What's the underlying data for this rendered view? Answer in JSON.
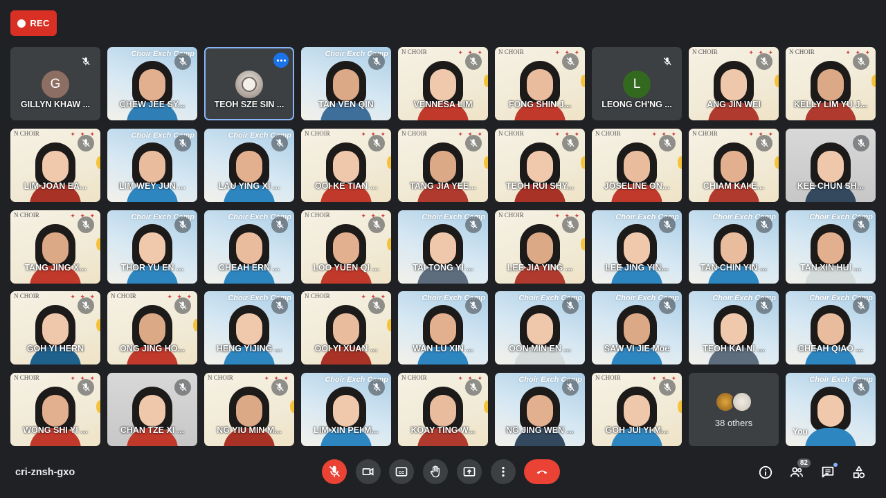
{
  "recording": {
    "label": "REC"
  },
  "meeting_code": "cri-znsh-gxo",
  "participants_count": "82",
  "colors": {
    "accent": "#1a73e8",
    "danger": "#ea4335",
    "bg": "#202124",
    "tile": "#3c4043"
  },
  "tile_decor": {
    "choir": "N CHOIR",
    "camp": "Choir Exch Camp",
    "stars": "✦ ✦ ✦"
  },
  "tiles": [
    {
      "name": "GILLYN KHAW ...",
      "kind": "avatar",
      "initial": "G",
      "avatar_color": "#8d6e63"
    },
    {
      "name": "CHEW JEE SY...",
      "kind": "video",
      "bg": "bg1",
      "shirt": "#2f7fb6"
    },
    {
      "name": "TEOH SZE SIN ...",
      "kind": "photo-avatar",
      "selected": true
    },
    {
      "name": "TAN VEN QIN",
      "kind": "video",
      "bg": "bg1",
      "shirt": "#3d6f9a"
    },
    {
      "name": "VENNESA LIM",
      "kind": "video",
      "bg": "bg0",
      "shirt": "#c0392b"
    },
    {
      "name": "FONG SHIN J...",
      "kind": "video",
      "bg": "bg0",
      "shirt": "#c0392b"
    },
    {
      "name": "LEONG CH'NG ...",
      "kind": "avatar",
      "initial": "L",
      "avatar_color": "#33691e"
    },
    {
      "name": "ANG JIN WEI",
      "kind": "video",
      "bg": "bg0",
      "shirt": "#b03a2e"
    },
    {
      "name": "KELLY LIM YU J...",
      "kind": "video",
      "bg": "bg0",
      "shirt": "#b03a2e"
    },
    {
      "name": "LIM JOAN EA...",
      "kind": "video",
      "bg": "bg0",
      "shirt": "#a93226"
    },
    {
      "name": "LIM WEY JUN ...",
      "kind": "video",
      "bg": "bg1",
      "shirt": "#2e86c1"
    },
    {
      "name": "LAU YING XI ...",
      "kind": "video",
      "bg": "bg1",
      "shirt": "#2e86c1"
    },
    {
      "name": "OOI KE TIAN ...",
      "kind": "video",
      "bg": "bg0",
      "shirt": "#c0392b"
    },
    {
      "name": "TANG JIA YEE...",
      "kind": "video",
      "bg": "bg0",
      "shirt": "#b03a2e"
    },
    {
      "name": "TEOH RUI SHY...",
      "kind": "video",
      "bg": "bg0",
      "shirt": "#a93226"
    },
    {
      "name": "JOSELINE ON...",
      "kind": "video",
      "bg": "bg0",
      "shirt": "#c0392b"
    },
    {
      "name": "CHIAM KAI E...",
      "kind": "video",
      "bg": "bg0",
      "shirt": "#b03a2e"
    },
    {
      "name": "KEE CHUN SH...",
      "kind": "video",
      "bg": "bg2",
      "shirt": "#34495e"
    },
    {
      "name": "TANG JING X...",
      "kind": "video",
      "bg": "bg0",
      "shirt": "#c0392b"
    },
    {
      "name": "THOR YU EN ...",
      "kind": "video",
      "bg": "bg1",
      "shirt": "#2e86c1"
    },
    {
      "name": "CHEAH ERN ...",
      "kind": "video",
      "bg": "bg1",
      "shirt": "#2e86c1"
    },
    {
      "name": "LOO YUEN QI ...",
      "kind": "video",
      "bg": "bg0",
      "shirt": "#c0392b"
    },
    {
      "name": "TAI TONG YI ...",
      "kind": "video",
      "bg": "bg1",
      "shirt": "#5d6d7e"
    },
    {
      "name": "LEE JIA YING ...",
      "kind": "video",
      "bg": "bg0",
      "shirt": "#b03a2e"
    },
    {
      "name": "LEE JING YIN...",
      "kind": "video",
      "bg": "bg1",
      "shirt": "#2e86c1"
    },
    {
      "name": "TAN CHIN YIN ...",
      "kind": "video",
      "bg": "bg1",
      "shirt": "#2e86c1"
    },
    {
      "name": "TAN XIN HUI ...",
      "kind": "video",
      "bg": "bg1",
      "shirt": "#d5dbdb"
    },
    {
      "name": "GOH YI HERN",
      "kind": "video",
      "bg": "bg0",
      "shirt": "#1f618d"
    },
    {
      "name": "ONG JING HO...",
      "kind": "video",
      "bg": "bg0",
      "shirt": "#c0392b"
    },
    {
      "name": "HENG YIJING ...",
      "kind": "video",
      "bg": "bg1",
      "shirt": "#2e86c1"
    },
    {
      "name": "OOI YI XUAN ...",
      "kind": "video",
      "bg": "bg0",
      "shirt": "#a93226"
    },
    {
      "name": "WAN LU XIN ...",
      "kind": "video",
      "bg": "bg1",
      "shirt": "#2e86c1"
    },
    {
      "name": "OON MIN EN ...",
      "kind": "video",
      "bg": "bg1",
      "shirt": "#d5dbdb"
    },
    {
      "name": "SAW VI JIE Moe",
      "kind": "video",
      "bg": "bg1",
      "shirt": "#2e86c1"
    },
    {
      "name": "TEOH KAI NI ...",
      "kind": "video",
      "bg": "bg1",
      "shirt": "#5d6d7e"
    },
    {
      "name": "CHEAH QIAO ...",
      "kind": "video",
      "bg": "bg1",
      "shirt": "#2e86c1"
    },
    {
      "name": "WONG SHI YI ...",
      "kind": "video",
      "bg": "bg0",
      "shirt": "#c0392b"
    },
    {
      "name": "CHAN TZE XI ...",
      "kind": "video",
      "bg": "bg2",
      "shirt": "#c0392b"
    },
    {
      "name": "NG YIU MIN M...",
      "kind": "video",
      "bg": "bg0",
      "shirt": "#a93226"
    },
    {
      "name": "LIM XIN PEI M...",
      "kind": "video",
      "bg": "bg1",
      "shirt": "#2e86c1"
    },
    {
      "name": "KOAY TING W...",
      "kind": "video",
      "bg": "bg0",
      "shirt": "#b03a2e"
    },
    {
      "name": "NG JING WEN ...",
      "kind": "video",
      "bg": "bg1",
      "shirt": "#34495e"
    },
    {
      "name": "GOH JUI YI M...",
      "kind": "video",
      "bg": "bg0",
      "shirt": "#2e86c1"
    },
    {
      "name": "38 others",
      "kind": "others"
    },
    {
      "name": "You",
      "kind": "self",
      "bg": "bg1",
      "shirt": "#2e86c1"
    }
  ],
  "controls": [
    {
      "id": "mic",
      "icon": "mic-off-icon",
      "red": true
    },
    {
      "id": "camera",
      "icon": "camera-icon",
      "red": false
    },
    {
      "id": "captions",
      "icon": "captions-icon",
      "red": false
    },
    {
      "id": "raise-hand",
      "icon": "hand-icon",
      "red": false
    },
    {
      "id": "present",
      "icon": "present-icon",
      "red": false
    },
    {
      "id": "more",
      "icon": "more-vert-icon",
      "red": false
    },
    {
      "id": "leave",
      "icon": "end-call-icon",
      "red": true
    }
  ],
  "right_controls": [
    "info-icon",
    "people-icon",
    "chat-icon",
    "activities-icon"
  ]
}
